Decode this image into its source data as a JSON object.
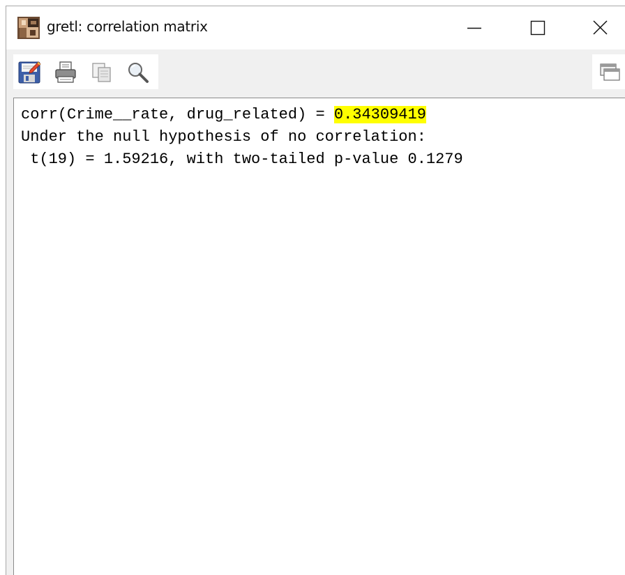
{
  "window": {
    "title": "gretl: correlation matrix",
    "app_icon": "gretl-app-icon",
    "controls": {
      "minimize_icon": "minimize-icon",
      "maximize_icon": "maximize-icon",
      "close_icon": "close-icon"
    }
  },
  "toolbar": {
    "left_buttons": [
      {
        "icon": "save-icon"
      },
      {
        "icon": "print-icon"
      },
      {
        "icon": "copy-icon"
      },
      {
        "icon": "find-icon"
      }
    ],
    "right_buttons": [
      {
        "icon": "window-list-icon"
      }
    ]
  },
  "output": {
    "line1_prefix": "corr(Crime__rate, drug_related) = ",
    "line1_value": "0.34309419",
    "line2": "Under the null hypothesis of no correlation:",
    "line3": " t(19) = 1.59216, with two-tailed p-value 0.1279"
  },
  "colors": {
    "highlight": "#ffff00",
    "text": "#000000",
    "titlebar": "#ffffff",
    "toolbar": "#f0f0f0"
  }
}
